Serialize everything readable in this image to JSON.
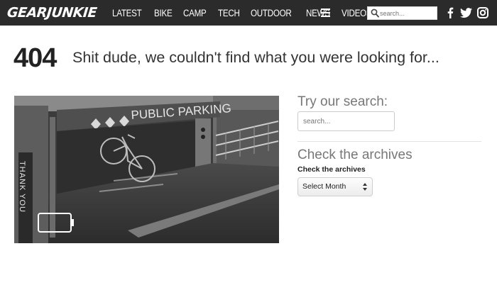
{
  "header": {
    "logo_text": "GEARJUNKIE",
    "nav": [
      {
        "label": "LATEST"
      },
      {
        "label": "BIKE"
      },
      {
        "label": "CAMP"
      },
      {
        "label": "TECH"
      },
      {
        "label": "OUTDOOR"
      },
      {
        "label": "NEWS"
      },
      {
        "label": "VIDEOS"
      }
    ],
    "search_placeholder": "search...",
    "background": "#2b2b2b",
    "social_icons": [
      "facebook-icon",
      "twitter-icon",
      "instagram-icon"
    ]
  },
  "main": {
    "code": "404",
    "message": "Shit dude, we couldn't find what you were looking for...",
    "image": {
      "sign_text": "PUBLIC PARKING",
      "pillar_text": "THANK YOU"
    }
  },
  "sidebar": {
    "search_heading": "Try our search:",
    "search_placeholder": "search...",
    "archives_heading": "Check the archives",
    "archives_label": "Check the archives",
    "archives_select_value": "Select Month"
  }
}
